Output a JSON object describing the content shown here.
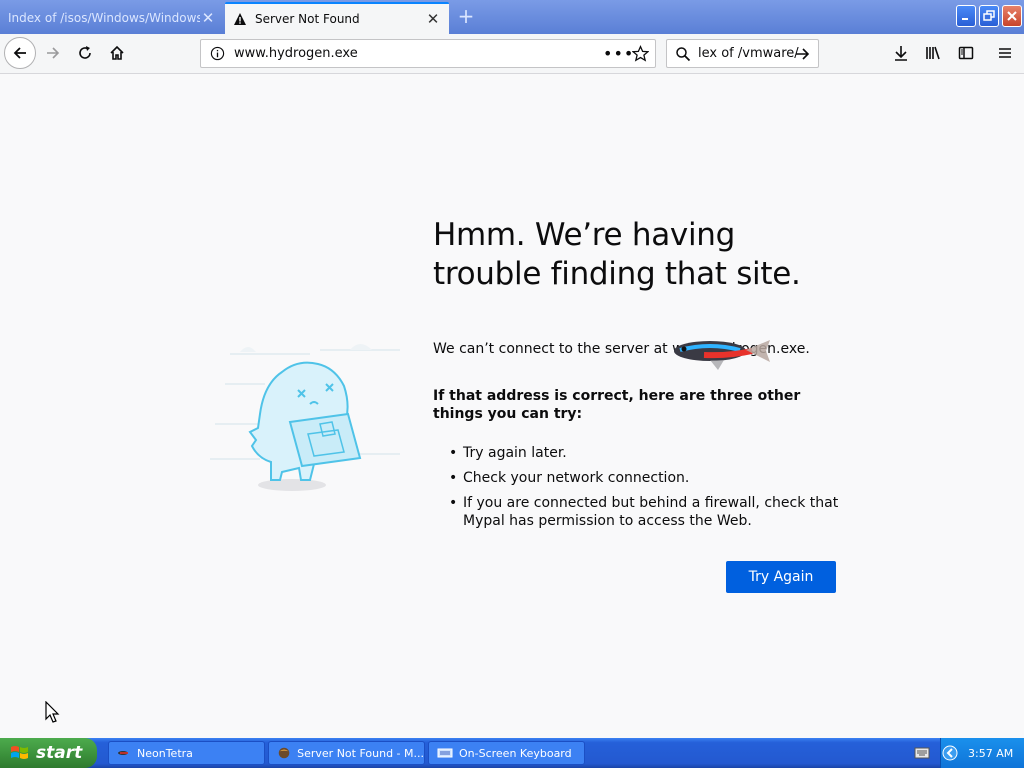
{
  "browser": {
    "tabs": [
      {
        "label": "Index of /isos/Windows/Windows_Vist",
        "active": false
      },
      {
        "label": "Server Not Found",
        "active": true
      }
    ],
    "address": "www.hydrogen.exe",
    "search_value": "lex of /vmware/"
  },
  "error_page": {
    "title": "Hmm. We’re having trouble finding that site.",
    "description": "We can’t connect to the server at www.hydrogen.exe.",
    "subtitle": "If that address is correct, here are three other things you can try:",
    "tips": [
      "Try again later.",
      "Check your network connection.",
      "If you are connected but behind a firewall, check that Mypal has permission to access the Web."
    ],
    "button_label": "Try Again"
  },
  "taskbar": {
    "start_label": "start",
    "tasks": [
      {
        "label": "NeonTetra"
      },
      {
        "label": "Server Not Found - M..."
      },
      {
        "label": "On-Screen Keyboard"
      }
    ],
    "clock": "3:57 AM"
  },
  "colors": {
    "accent": "#0060df",
    "tab_highlight": "#0a84ff",
    "illustration": "#4fc3e8"
  }
}
